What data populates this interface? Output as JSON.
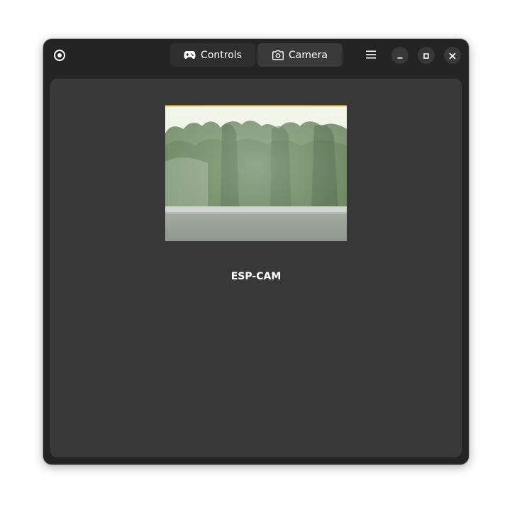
{
  "window": {
    "app_icon": "record-icon",
    "tabs": [
      {
        "label": "Controls",
        "icon": "gamepad-icon",
        "active": false
      },
      {
        "label": "Camera",
        "icon": "camera-icon",
        "active": true
      }
    ],
    "menu_icon": "hamburger-menu-icon",
    "controls": [
      "minimize-icon",
      "maximize-icon",
      "close-icon"
    ]
  },
  "camera_view": {
    "caption": "ESP-CAM"
  },
  "colors": {
    "window_bg": "#242424",
    "content_bg": "#383838",
    "active_tab_bg": "#3a3a3a",
    "text": "#ffffff"
  }
}
